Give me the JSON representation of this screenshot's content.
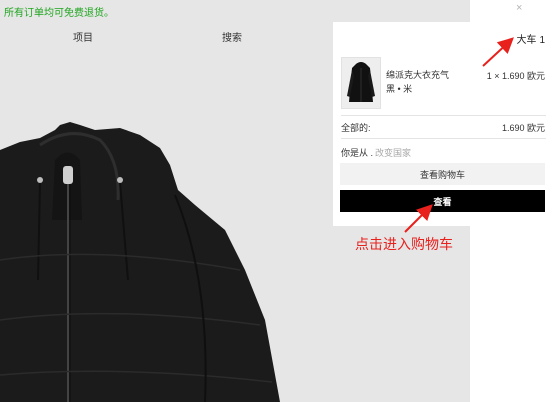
{
  "banner": {
    "text": "所有订单均可免费退货。"
  },
  "nav": {
    "items_label": "项目",
    "search_label": "搜索"
  },
  "cart": {
    "label": "大车",
    "count": "1",
    "item": {
      "name": "绵派克大衣充气",
      "variant": "黑 • 米",
      "price": "1 × 1.690 欧元"
    },
    "total_label": "全部的:",
    "total_value": "1.690 欧元",
    "ship_from": "你是从 .",
    "change_country": "改变国家",
    "view_cart_button": "查看购物车",
    "checkout_button": "查看"
  },
  "annotation": {
    "text": "点击进入购物车",
    "color": "#e8211d"
  },
  "colors": {
    "banner_green": "#1ea51e",
    "checkout_black": "#000000",
    "annotation_red": "#e8211d"
  }
}
